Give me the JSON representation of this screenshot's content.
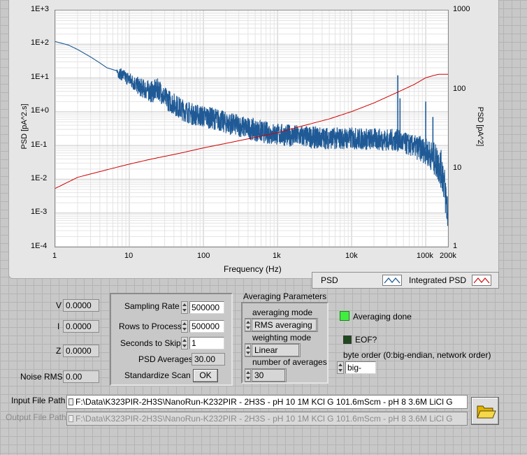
{
  "chart_data": {
    "type": "line",
    "title": "",
    "xlabel": "Frequency (Hz)",
    "ylabel": "PSD [pA^2.s]",
    "y2label": "PSD [pA^2]",
    "xscale": "log",
    "yscale": "log",
    "y2scale": "log",
    "xlim": [
      1,
      200000
    ],
    "ylim": [
      0.0001,
      1000
    ],
    "y2lim": [
      1,
      1000
    ],
    "x_tick_labels": [
      "1",
      "10",
      "100",
      "1k",
      "10k",
      "100k",
      "200k"
    ],
    "y_tick_labels": [
      "1E-4",
      "1E-3",
      "1E-2",
      "1E-1",
      "1E+0",
      "1E+1",
      "1E+2",
      "1E+3"
    ],
    "y2_tick_labels": [
      "1",
      "10",
      "100",
      "1000"
    ],
    "grid": true,
    "legend_position": "bottom-right",
    "series": [
      {
        "name": "PSD",
        "axis": "left",
        "color": "#1f5a96",
        "x": [
          1,
          1.5,
          2,
          3,
          4,
          5,
          7,
          10,
          14,
          20,
          25,
          30,
          40,
          50,
          70,
          100,
          150,
          200,
          300,
          500,
          700,
          1000,
          1500,
          2000,
          3000,
          5000,
          7000,
          10000,
          15000,
          20000,
          30000,
          40000,
          41000,
          42000,
          50000,
          60000,
          70000,
          80000,
          90000,
          100000,
          110000,
          120000,
          130000,
          150000,
          170000,
          200000
        ],
        "y": [
          120,
          95,
          70,
          42,
          28,
          20,
          16,
          10,
          6,
          4.5,
          5.5,
          3,
          2,
          1.4,
          1.0,
          0.85,
          0.7,
          0.55,
          0.45,
          0.33,
          0.28,
          0.25,
          0.23,
          0.22,
          0.2,
          0.19,
          0.19,
          0.19,
          0.18,
          0.18,
          0.17,
          0.17,
          12,
          0.16,
          0.14,
          0.12,
          0.11,
          0.1,
          0.09,
          0.08,
          0.07,
          0.06,
          0.05,
          0.035,
          0.02,
          0.0012
        ],
        "y_spread": [
          0,
          0,
          0,
          0,
          0,
          0,
          0.15,
          0.2,
          0.25,
          0.3,
          0.3,
          0.3,
          0.3,
          0.3,
          0.3,
          0.3,
          0.3,
          0.3,
          0.3,
          0.3,
          0.3,
          0.3,
          0.3,
          0.3,
          0.3,
          0.3,
          0.3,
          0.3,
          0.3,
          0.3,
          0.3,
          0.3,
          0,
          0.3,
          0.3,
          0.3,
          0.3,
          0.35,
          0.35,
          0.35,
          0.4,
          0.4,
          0.45,
          0.5,
          0.55,
          0.6
        ],
        "spikes": [
          {
            "x": 42000,
            "y": 12
          },
          {
            "x": 45000,
            "y": 2.5
          },
          {
            "x": 100000,
            "y": 2
          },
          {
            "x": 125000,
            "y": 0.7
          },
          {
            "x": 140000,
            "y": 0.05
          }
        ]
      },
      {
        "name": "Integrated PSD",
        "axis": "right",
        "color": "#d00000",
        "x": [
          1,
          2,
          5,
          10,
          20,
          50,
          100,
          200,
          500,
          1000,
          2000,
          5000,
          10000,
          20000,
          40000,
          70000,
          100000,
          130000,
          150000,
          200000
        ],
        "y": [
          5.5,
          7.6,
          9.5,
          11.2,
          13,
          15.5,
          18,
          20.5,
          24.5,
          28,
          33.5,
          42,
          52,
          67,
          90,
          115,
          140,
          150,
          155,
          155
        ]
      }
    ]
  },
  "graph": {
    "xlabel": "Frequency (Hz)",
    "ylabel": "PSD [pA^2.s]",
    "y2label": "PSD [pA^2]",
    "y_ticks": [
      "1E+3",
      "1E+2",
      "1E+1",
      "1E+0",
      "1E-1",
      "1E-2",
      "1E-3",
      "1E-4"
    ],
    "y2_ticks": [
      "1000",
      "100",
      "10",
      "1"
    ],
    "x_ticks": [
      "1",
      "10",
      "100",
      "1k",
      "10k",
      "100k",
      "200k"
    ]
  },
  "legend": {
    "psd_label": "PSD",
    "integrated_label": "Integrated PSD",
    "psd_color": "#1f5a96",
    "integrated_color": "#d00000"
  },
  "readouts": {
    "v_label": "V",
    "v_value": "0.0000",
    "i_label": "I",
    "i_value": "0.0000",
    "z_label": "Z",
    "z_value": "0.0000",
    "noise_label": "Noise RMS",
    "noise_value": "0.00"
  },
  "settings": {
    "sampling_rate_label": "Sampling Rate",
    "sampling_rate_value": "500000",
    "rows_label": "Rows to Process",
    "rows_value": "500000",
    "skip_label": "Seconds to Skip",
    "skip_value": "1",
    "psd_avg_label": "PSD Averages",
    "psd_avg_value": "30.00",
    "standardize_label": "Standardize Scan",
    "ok_label": "OK"
  },
  "averaging": {
    "title": "Averaging Parameters",
    "mode_label": "averaging mode",
    "mode_value": "RMS averaging",
    "weighting_label": "weighting mode",
    "weighting_value": "Linear",
    "number_label": "number of averages",
    "number_value": "30"
  },
  "status": {
    "averaging_done_label": "Averaging done",
    "averaging_done_color": "#3ef03e",
    "eof_label": "EOF?",
    "eof_color": "#1f4a1f",
    "byte_order_label": "byte order (0:big-endian, network order)",
    "byte_order_value": "big-"
  },
  "files": {
    "input_label": "Input File Path",
    "input_value": "F:\\Data\\K323PIR-2H3S\\NanoRun-K232PIR - 2H3S - pH 10 1M KCl G 101.6mScm - pH 8 3.6M LiCl G",
    "output_label": "Output File Path",
    "output_value": "F:\\Data\\K323PIR-2H3S\\NanoRun-K232PIR - 2H3S - pH 10 1M KCl G 101.6mScm - pH 8 3.6M LiCl G"
  }
}
